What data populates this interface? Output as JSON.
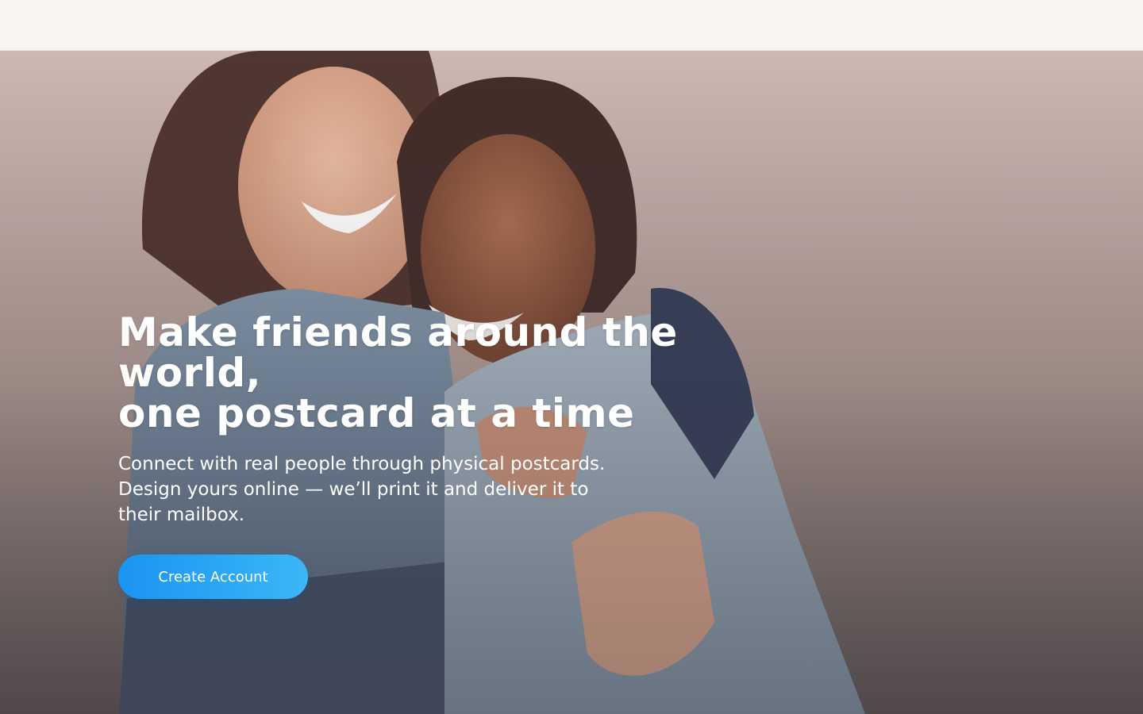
{
  "header": {},
  "hero": {
    "headline_line1": "Make friends around the world,",
    "headline_line2": "one postcard at a time",
    "subtext": "Connect with real people through physical postcards. Design yours online — we’ll print it and deliver it to their mailbox.",
    "cta_label": "Create Account",
    "photo": "photo of two smiling women hugging"
  },
  "colors": {
    "accent": "#1a94f2",
    "accent_light": "#3bb7f7",
    "topbar_bg": "#faf5f1"
  }
}
